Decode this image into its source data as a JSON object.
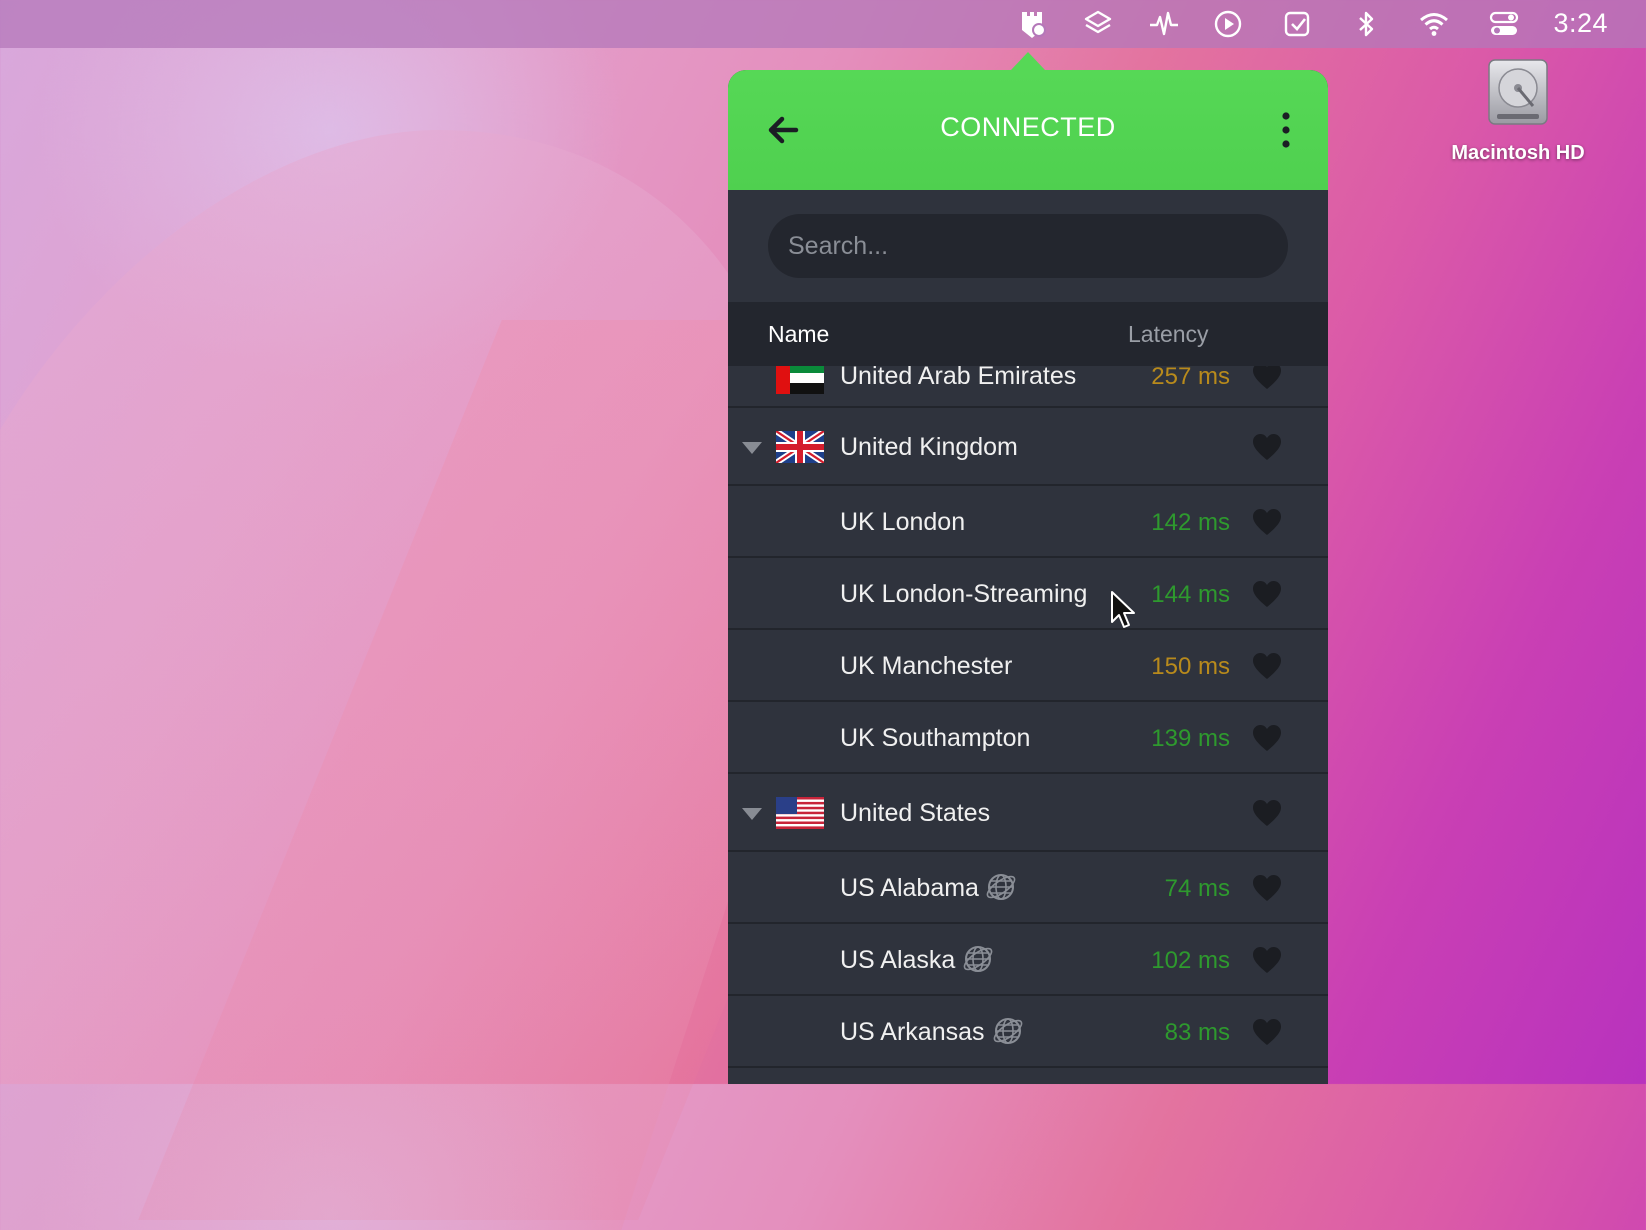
{
  "menubar": {
    "icons": [
      "vpn-app-icon",
      "layers-icon",
      "activity-icon",
      "play-icon",
      "checkbox-icon",
      "bluetooth-icon",
      "wifi-icon",
      "control-center-icon"
    ],
    "clock": "3:24"
  },
  "desktop": {
    "drive_label": "Macintosh HD"
  },
  "vpn": {
    "status": "CONNECTED",
    "accent_color": "#56d856",
    "search_placeholder": "Search...",
    "columns": {
      "name": "Name",
      "latency": "Latency"
    },
    "rows": [
      {
        "type": "country",
        "name": "United Arab Emirates",
        "flag": "uae-flag",
        "latency": "257 ms",
        "latency_level": "amber",
        "expandable": false
      },
      {
        "type": "country",
        "name": "United Kingdom",
        "flag": "uk-flag",
        "latency": "",
        "expandable": true
      },
      {
        "type": "server",
        "name": "UK London",
        "latency": "142 ms",
        "latency_level": "green"
      },
      {
        "type": "server",
        "name": "UK London-Streaming",
        "latency": "144 ms",
        "latency_level": "green"
      },
      {
        "type": "server",
        "name": "UK Manchester",
        "latency": "150 ms",
        "latency_level": "amber"
      },
      {
        "type": "server",
        "name": "UK Southampton",
        "latency": "139 ms",
        "latency_level": "green"
      },
      {
        "type": "country",
        "name": "United States",
        "flag": "us-flag",
        "latency": "",
        "expandable": true
      },
      {
        "type": "server",
        "name": "US Alabama",
        "latency": "74 ms",
        "latency_level": "green",
        "virtual": true
      },
      {
        "type": "server",
        "name": "US Alaska",
        "latency": "102 ms",
        "latency_level": "green",
        "virtual": true
      },
      {
        "type": "server",
        "name": "US Arkansas",
        "latency": "83 ms",
        "latency_level": "green",
        "virtual": true
      }
    ]
  }
}
